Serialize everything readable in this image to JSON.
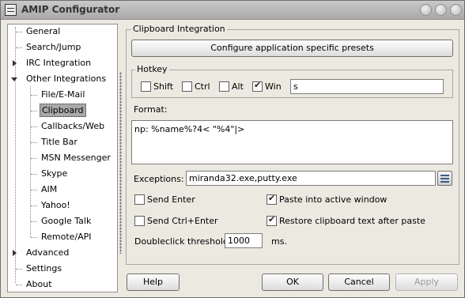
{
  "window": {
    "title": "AMIP Configurator"
  },
  "tree": {
    "general": "General",
    "search_jump": "Search/Jump",
    "irc_integration": "IRC Integration",
    "other_integrations": "Other Integrations",
    "file_email": "File/E-Mail",
    "clipboard": "Clipboard",
    "callbacks_web": "Callbacks/Web",
    "title_bar": "Title Bar",
    "msn_messenger": "MSN Messenger",
    "skype": "Skype",
    "aim": "AIM",
    "yahoo": "Yahoo!",
    "google_talk": "Google Talk",
    "remote_api": "Remote/API",
    "advanced": "Advanced",
    "settings": "Settings",
    "about": "About",
    "selected": "Clipboard"
  },
  "panel": {
    "group_title": "Clipboard Integration",
    "presets_button": "Configure application specific presets",
    "hotkey": {
      "title": "Hotkey",
      "shift": {
        "label": "Shift",
        "checked": false
      },
      "ctrl": {
        "label": "Ctrl",
        "checked": false
      },
      "alt": {
        "label": "Alt",
        "checked": false
      },
      "win": {
        "label": "Win",
        "checked": true
      },
      "key_value": "s"
    },
    "format_label": "Format:",
    "format_value": "np: %name%?4< \"%4\"|>",
    "exceptions_label": "Exceptions:",
    "exceptions_value": "miranda32.exe,putty.exe",
    "send_enter": {
      "label": "Send Enter",
      "checked": false
    },
    "send_ctrl_enter": {
      "label": "Send Ctrl+Enter",
      "checked": false
    },
    "paste_active": {
      "label": "Paste into active window",
      "checked": true
    },
    "restore_clipboard": {
      "label": "Restore clipboard text after paste",
      "checked": true
    },
    "doubleclick_label": "Doubleclick threshold",
    "doubleclick_value": "1000",
    "doubleclick_unit": "ms."
  },
  "buttons": {
    "help": "Help",
    "ok": "OK",
    "cancel": "Cancel",
    "apply": "Apply"
  },
  "icons": {
    "system_menu": "window-menu-icon",
    "title_buttons": [
      "minimize-icon",
      "maximize-icon",
      "close-icon"
    ],
    "exceptions_picker": "list-picker-icon"
  }
}
